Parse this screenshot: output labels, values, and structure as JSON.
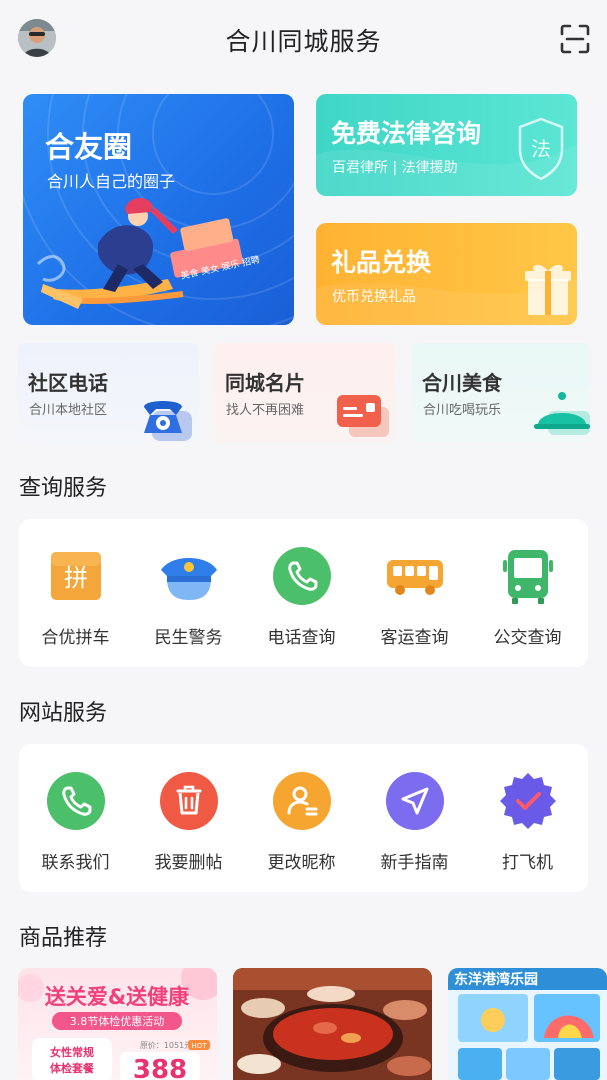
{
  "header": {
    "title": "合川同城服务",
    "avatar_icon": "user-avatar",
    "scan_icon": "scan-icon"
  },
  "banners": {
    "circle": {
      "title": "合友圈",
      "subtitle": "合川人自己的圈子",
      "sign_text": "美食 美女 娱乐 招聘"
    },
    "law": {
      "title": "免费法律咨询",
      "subtitle": "百君律所 | 法律援助",
      "badge": "法"
    },
    "gift": {
      "title": "礼品兑换",
      "subtitle": "优币兑换礼品"
    }
  },
  "mini_cards": [
    {
      "title": "社区电话",
      "subtitle": "合川本地社区",
      "icon": "telephone-icon"
    },
    {
      "title": "同城名片",
      "subtitle": "找人不再困难",
      "icon": "business-card-icon"
    },
    {
      "title": "合川美食",
      "subtitle": "合川吃喝玩乐",
      "icon": "food-cloche-icon"
    }
  ],
  "query_section": {
    "title": "查询服务",
    "items": [
      {
        "label": "合优拼车",
        "icon": "carpool-icon",
        "glyph": "拼"
      },
      {
        "label": "民生警务",
        "icon": "police-cap-icon"
      },
      {
        "label": "电话查询",
        "icon": "phone-icon"
      },
      {
        "label": "客运查询",
        "icon": "coach-bus-icon"
      },
      {
        "label": "公交查询",
        "icon": "bus-icon"
      }
    ]
  },
  "site_section": {
    "title": "网站服务",
    "items": [
      {
        "label": "联系我们",
        "icon": "phone-icon"
      },
      {
        "label": "我要删帖",
        "icon": "trash-icon"
      },
      {
        "label": "更改昵称",
        "icon": "user-edit-icon"
      },
      {
        "label": "新手指南",
        "icon": "navigation-arrow-icon"
      },
      {
        "label": "打飞机",
        "icon": "badge-check-icon"
      }
    ]
  },
  "products_section": {
    "title": "商品推荐",
    "items": [
      {
        "headline": "送关爱&送健康",
        "ribbon": "3.8节体检优惠活动",
        "tag": "女性常规\n体检套餐",
        "price": "388",
        "old_price": "原价：1051元",
        "hot": "HOT"
      },
      {
        "headline": ""
      },
      {
        "headline": "东洋港湾乐园"
      }
    ]
  },
  "colors": {
    "blue_banner": "#2f8df6",
    "teal_banner": "#3fd6c6",
    "orange_banner": "#ffb232",
    "green_icon": "#4cbf6b",
    "red_icon": "#f05a45",
    "orange_icon": "#f7a531",
    "purple_icon": "#7c6cf0"
  }
}
